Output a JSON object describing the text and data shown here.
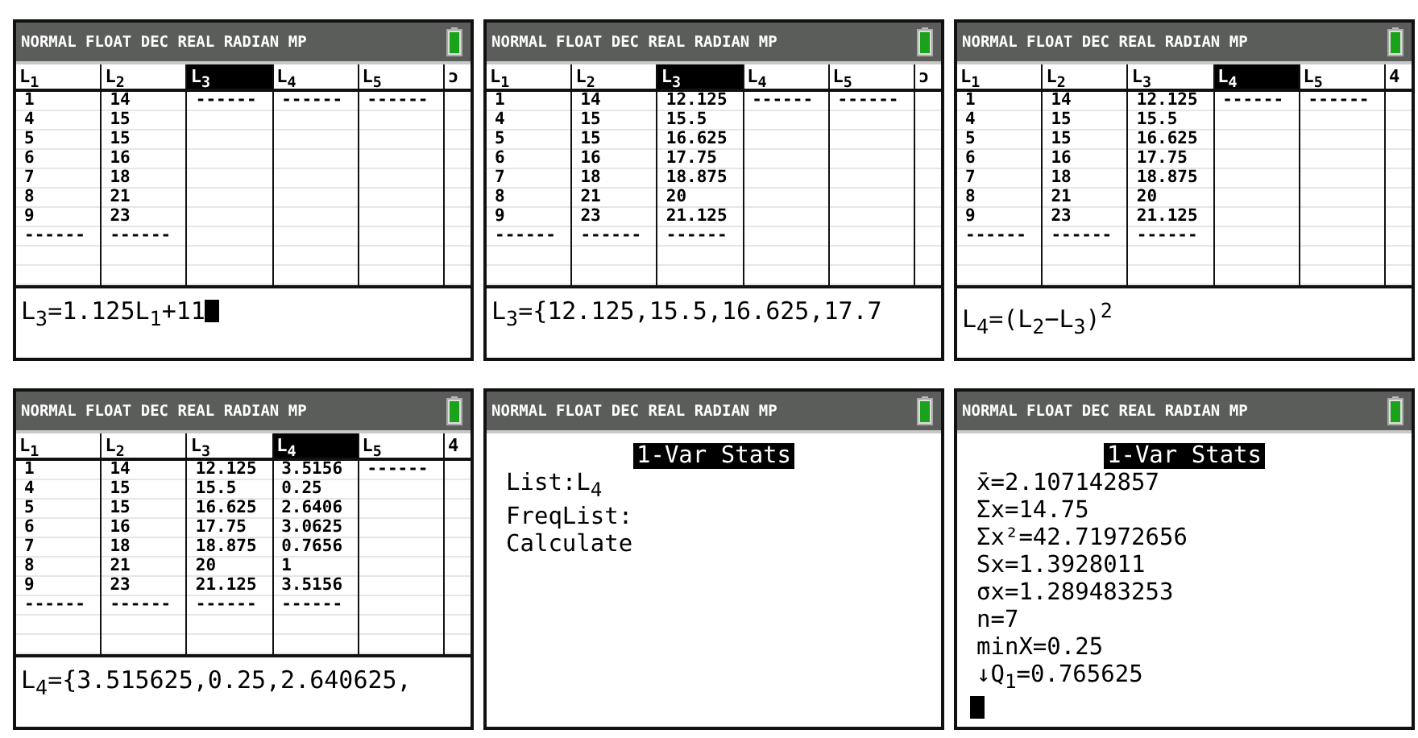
{
  "screens": [
    {
      "kind": "list_editor",
      "status": "NORMAL FLOAT DEC REAL RADIAN MP",
      "columns": [
        {
          "header": "L$_{1}$",
          "selected": false,
          "cells": [
            "1",
            "4",
            "5",
            "6",
            "7",
            "8",
            "9",
            "------"
          ]
        },
        {
          "header": "L$_{2}$",
          "selected": false,
          "cells": [
            "14",
            "15",
            "15",
            "16",
            "18",
            "21",
            "23",
            "------"
          ]
        },
        {
          "header": "L$_{3}$",
          "selected": true,
          "cells": [
            "------"
          ]
        },
        {
          "header": "L$_{4}$",
          "selected": false,
          "cells": [
            "------"
          ]
        },
        {
          "header": "L$_{5}$",
          "selected": false,
          "cells": [
            "------"
          ]
        },
        {
          "header": "ɔ",
          "selected": false
        }
      ],
      "entry": "L$_{3}$=1.125L$_{1}$+11",
      "cursor": true
    },
    {
      "kind": "list_editor",
      "status": "NORMAL FLOAT DEC REAL RADIAN MP",
      "columns": [
        {
          "header": "L$_{1}$",
          "selected": false,
          "cells": [
            "1",
            "4",
            "5",
            "6",
            "7",
            "8",
            "9",
            "------"
          ]
        },
        {
          "header": "L$_{2}$",
          "selected": false,
          "cells": [
            "14",
            "15",
            "15",
            "16",
            "18",
            "21",
            "23",
            "------"
          ]
        },
        {
          "header": "L$_{3}$",
          "selected": true,
          "cells": [
            "12.125",
            "15.5",
            "16.625",
            "17.75",
            "18.875",
            "20",
            "21.125",
            "------"
          ]
        },
        {
          "header": "L$_{4}$",
          "selected": false,
          "cells": [
            "------"
          ]
        },
        {
          "header": "L$_{5}$",
          "selected": false,
          "cells": [
            "------"
          ]
        },
        {
          "header": "ɔ",
          "selected": false
        }
      ],
      "entry": "L$_{3}$={12.125,15.5,16.625,17.7",
      "cursor": false
    },
    {
      "kind": "list_editor",
      "status": "NORMAL FLOAT DEC REAL RADIAN MP",
      "columns": [
        {
          "header": "L$_{1}$",
          "selected": false,
          "cells": [
            "1",
            "4",
            "5",
            "6",
            "7",
            "8",
            "9",
            "------"
          ]
        },
        {
          "header": "L$_{2}$",
          "selected": false,
          "cells": [
            "14",
            "15",
            "15",
            "16",
            "18",
            "21",
            "23",
            "------"
          ]
        },
        {
          "header": "L$_{3}$",
          "selected": false,
          "cells": [
            "12.125",
            "15.5",
            "16.625",
            "17.75",
            "18.875",
            "20",
            "21.125",
            "------"
          ]
        },
        {
          "header": "L$_{4}$",
          "selected": true,
          "cells": [
            "------"
          ]
        },
        {
          "header": "L$_{5}$",
          "selected": false,
          "cells": [
            "------"
          ]
        },
        {
          "header": "4",
          "selected": false
        }
      ],
      "entry": "L$_{4}$=(L$_{2}$−L$_{3}$)$^{2}$",
      "cursor": false
    },
    {
      "kind": "list_editor",
      "status": "NORMAL FLOAT DEC REAL RADIAN MP",
      "columns": [
        {
          "header": "L$_{1}$",
          "selected": false,
          "cells": [
            "1",
            "4",
            "5",
            "6",
            "7",
            "8",
            "9",
            "------"
          ]
        },
        {
          "header": "L$_{2}$",
          "selected": false,
          "cells": [
            "14",
            "15",
            "15",
            "16",
            "18",
            "21",
            "23",
            "------"
          ]
        },
        {
          "header": "L$_{3}$",
          "selected": false,
          "cells": [
            "12.125",
            "15.5",
            "16.625",
            "17.75",
            "18.875",
            "20",
            "21.125",
            "------"
          ]
        },
        {
          "header": "L$_{4}$",
          "selected": true,
          "cells": [
            "3.5156",
            "0.25",
            "2.6406",
            "3.0625",
            "0.7656",
            "1",
            "3.5156",
            "------"
          ]
        },
        {
          "header": "L$_{5}$",
          "selected": false,
          "cells": [
            "------"
          ]
        },
        {
          "header": "4",
          "selected": false
        }
      ],
      "entry": "L$_{4}$={3.515625,0.25,2.640625,",
      "cursor": false
    },
    {
      "kind": "stats",
      "status": "NORMAL FLOAT DEC REAL RADIAN MP",
      "title": "1-Var Stats",
      "lines": [
        "List:L$_{4}$",
        "FreqList:",
        "Calculate"
      ],
      "cursor": false
    },
    {
      "kind": "stats",
      "status": "NORMAL FLOAT DEC REAL RADIAN MP",
      "title": "1-Var Stats",
      "lines": [
        "x̄=2.107142857",
        "Σx=14.75",
        "Σx²=42.71972656",
        "Sx=1.3928011",
        "σx=1.289483253",
        "n=7",
        "minX=0.25",
        "↓Q$_{1}$=0.765625"
      ],
      "cursor": true
    }
  ]
}
